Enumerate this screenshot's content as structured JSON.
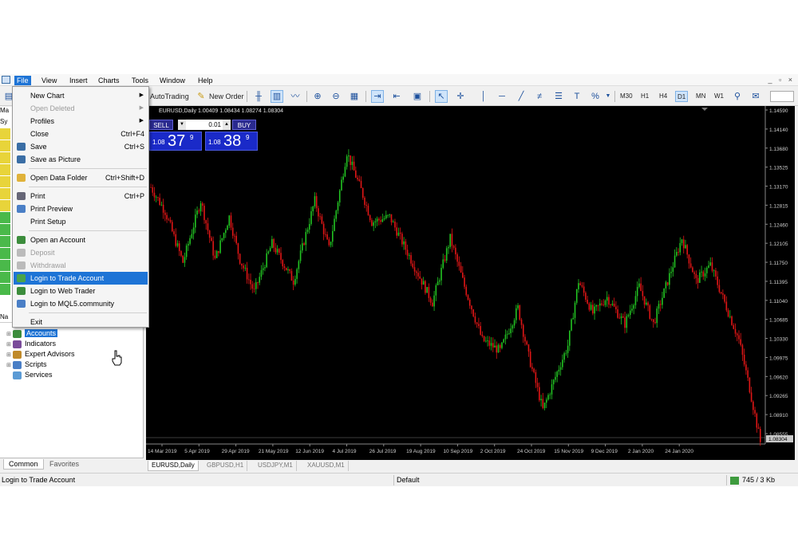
{
  "menubar": {
    "items": [
      "File",
      "View",
      "Insert",
      "Charts",
      "Tools",
      "Window",
      "Help"
    ],
    "active": "File",
    "window_controls": "_ ▫ ×"
  },
  "toolbar": {
    "autotrading": "AutoTrading",
    "new_order": "New Order",
    "timeframes": [
      "M30",
      "H1",
      "H4",
      "D1",
      "MN",
      "W1"
    ],
    "active_timeframe": "D1"
  },
  "file_menu": {
    "items": [
      {
        "label": "New Chart",
        "shortcut": "",
        "submenu": true,
        "enabled": true,
        "icon": ""
      },
      {
        "label": "Open Deleted",
        "shortcut": "",
        "submenu": true,
        "enabled": false,
        "icon": ""
      },
      {
        "label": "Profiles",
        "shortcut": "",
        "submenu": true,
        "enabled": true,
        "icon": ""
      },
      {
        "label": "Close",
        "shortcut": "Ctrl+F4",
        "submenu": false,
        "enabled": true,
        "icon": ""
      },
      {
        "label": "Save",
        "shortcut": "Ctrl+S",
        "submenu": false,
        "enabled": true,
        "icon": "save-icon"
      },
      {
        "label": "Save as Picture",
        "shortcut": "",
        "submenu": false,
        "enabled": true,
        "icon": "picture-icon"
      },
      {
        "label": "Open Data Folder",
        "shortcut": "Ctrl+Shift+D",
        "submenu": false,
        "enabled": true,
        "icon": "folder-icon"
      },
      {
        "label": "Print",
        "shortcut": "Ctrl+P",
        "submenu": false,
        "enabled": true,
        "icon": "print-icon"
      },
      {
        "label": "Print Preview",
        "shortcut": "",
        "submenu": false,
        "enabled": true,
        "icon": "print-preview-icon"
      },
      {
        "label": "Print Setup",
        "shortcut": "",
        "submenu": false,
        "enabled": true,
        "icon": ""
      },
      {
        "label": "Open an Account",
        "shortcut": "",
        "submenu": false,
        "enabled": true,
        "icon": "account-icon"
      },
      {
        "label": "Deposit",
        "shortcut": "",
        "submenu": false,
        "enabled": false,
        "icon": "deposit-icon"
      },
      {
        "label": "Withdrawal",
        "shortcut": "",
        "submenu": false,
        "enabled": false,
        "icon": "withdrawal-icon"
      },
      {
        "label": "Login to Trade Account",
        "shortcut": "",
        "submenu": false,
        "enabled": true,
        "icon": "login-icon",
        "highlighted": true
      },
      {
        "label": "Login to Web Trader",
        "shortcut": "",
        "submenu": false,
        "enabled": true,
        "icon": "web-icon"
      },
      {
        "label": "Login to MQL5.community",
        "shortcut": "",
        "submenu": false,
        "enabled": true,
        "icon": "mql5-icon"
      },
      {
        "label": "Exit",
        "shortcut": "",
        "submenu": false,
        "enabled": true,
        "icon": ""
      }
    ]
  },
  "left_panel": {
    "header_stubs": [
      "Ma",
      "Sy",
      "Na"
    ],
    "navigator": [
      {
        "label": "Accounts",
        "icon": "accounts-icon",
        "selected": true
      },
      {
        "label": "Indicators",
        "icon": "indicators-icon",
        "selected": false
      },
      {
        "label": "Expert Advisors",
        "icon": "expert-advisors-icon",
        "selected": false
      },
      {
        "label": "Scripts",
        "icon": "scripts-icon",
        "selected": false
      },
      {
        "label": "Services",
        "icon": "services-icon",
        "selected": false
      }
    ],
    "tabs": [
      "Common",
      "Favorites"
    ],
    "active_tab": "Common"
  },
  "chart": {
    "header": "EURUSD,Daily  1.00409 1.08434 1.08274 1.08304",
    "trade_panel": {
      "sell": "SELL",
      "buy": "BUY",
      "lot": "0.01",
      "bid_prefix": "1.08",
      "bid_big": "37",
      "bid_sup": "9",
      "ask_prefix": "1.08",
      "ask_big": "38",
      "ask_sup": "9"
    },
    "price_labels": [
      "1.14590",
      "1.14140",
      "1.13680",
      "1.13525",
      "1.13170",
      "1.12815",
      "1.12460",
      "1.12105",
      "1.11750",
      "1.11395",
      "1.11040",
      "1.10685",
      "1.10330",
      "1.09975",
      "1.09620",
      "1.09265",
      "1.08910",
      "1.08555"
    ],
    "current_price": "1.08304",
    "date_labels": [
      "14 Mar 2019",
      "5 Apr 2019",
      "29 Apr 2019",
      "21 May 2019",
      "12 Jun 2019",
      "4 Jul 2019",
      "26 Jul 2019",
      "19 Aug 2019",
      "10 Sep 2019",
      "2 Oct 2019",
      "24 Oct 2019",
      "15 Nov 2019",
      "9 Dec 2019",
      "2 Jan 2020",
      "24 Jan 2020"
    ],
    "colors": {
      "bull": "#22c322",
      "bear": "#e01616",
      "bg": "#000000",
      "axis_text": "#cfcfcf"
    }
  },
  "chart_tabs": {
    "items": [
      "EURUSD,Daily",
      "GBPUSD,H1",
      "USDJPY,M1",
      "XAUUSD,M1"
    ],
    "active": "EURUSD,Daily"
  },
  "statusbar": {
    "left": "Login to Trade Account",
    "profile": "Default",
    "traffic": "745 / 3 Kb"
  }
}
